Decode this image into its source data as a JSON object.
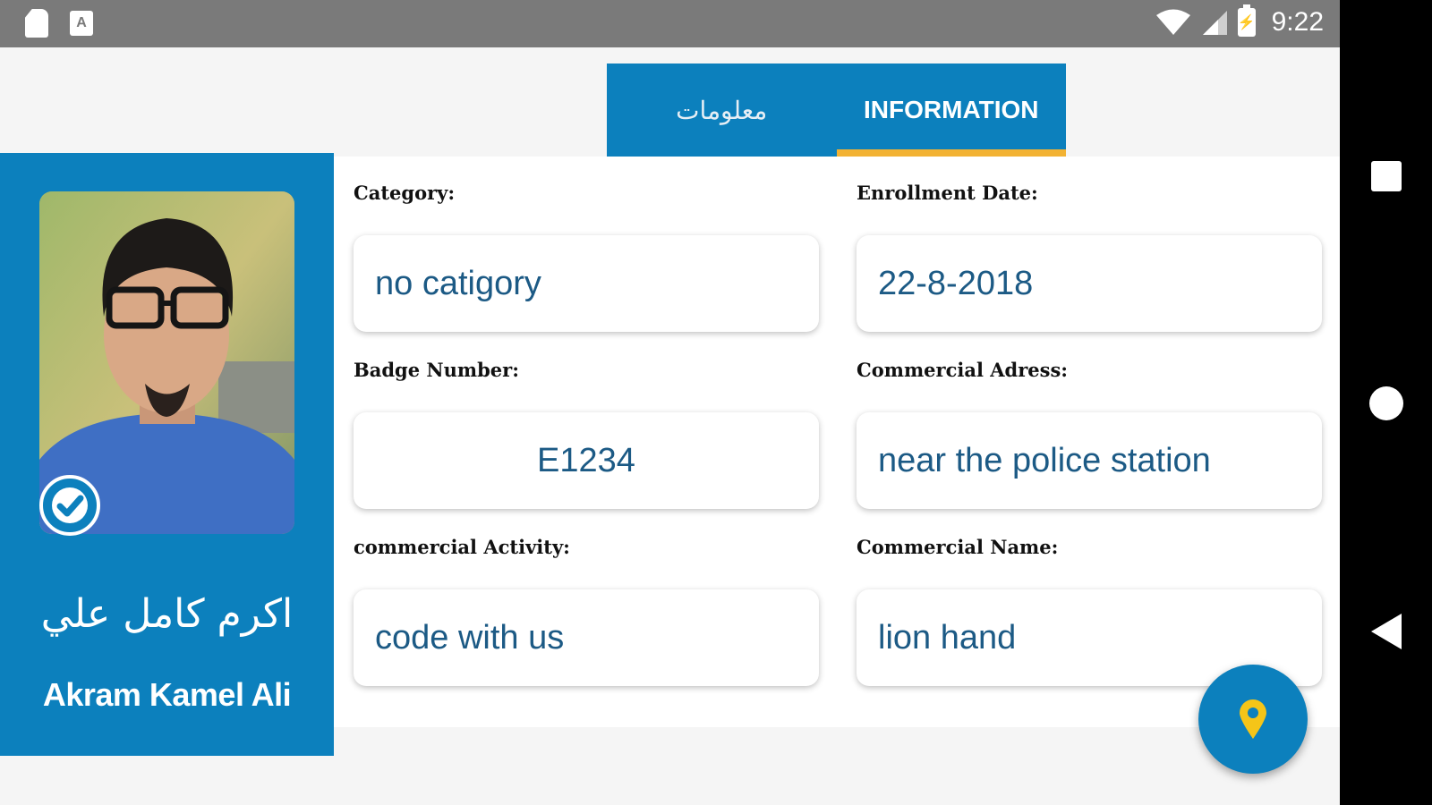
{
  "status_bar": {
    "time": "9:22",
    "battery_glyph": "⚡",
    "app_icon_letter": "A"
  },
  "tabs": [
    {
      "label": "معلومات",
      "active": false
    },
    {
      "label": "INFORMATION",
      "active": true
    }
  ],
  "profile": {
    "name_ar": "اكرم كامل علي",
    "name_en": "Akram Kamel Ali",
    "verified": true
  },
  "fields": {
    "category": {
      "label": "Category:",
      "value": "no catigory"
    },
    "enrollment_date": {
      "label": "Enrollment Date:",
      "value": "22-8-2018"
    },
    "badge_number": {
      "label": "Badge Number:",
      "value": "E1234"
    },
    "commercial_address": {
      "label": "Commercial Adress:",
      "value": "near the police station"
    },
    "commercial_activity": {
      "label": "commercial Activity:",
      "value": "code with us"
    },
    "commercial_name": {
      "label": "Commercial Name:",
      "value": "lion hand"
    }
  },
  "icons": {
    "fab": "location-pin-icon",
    "verified": "check-icon"
  },
  "colors": {
    "primary": "#0c80bd",
    "accent": "#f2b233",
    "value_text": "#1c5a85",
    "status_bar": "#7a7a7a"
  }
}
